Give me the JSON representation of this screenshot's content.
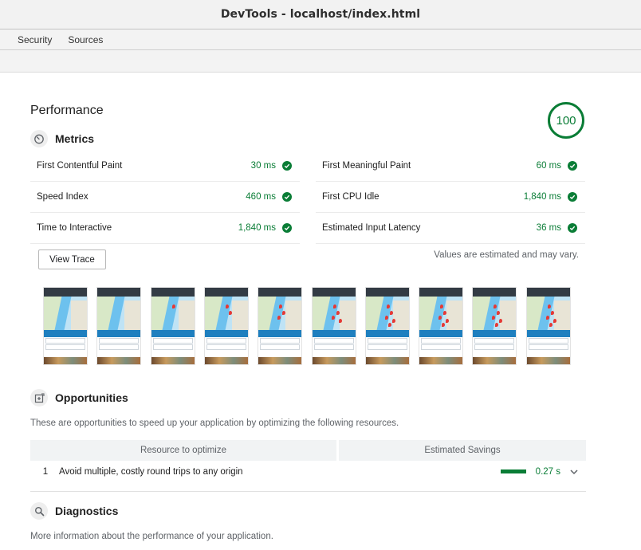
{
  "window": {
    "title": "DevTools - localhost/index.html"
  },
  "tabs": [
    {
      "label": "Security"
    },
    {
      "label": "Sources"
    }
  ],
  "report": {
    "category_title": "Performance",
    "score": "100",
    "metrics_heading": "Metrics",
    "metrics": [
      {
        "name": "First Contentful Paint",
        "value": "30 ms"
      },
      {
        "name": "First Meaningful Paint",
        "value": "60 ms"
      },
      {
        "name": "Speed Index",
        "value": "460 ms"
      },
      {
        "name": "First CPU Idle",
        "value": "1,840 ms"
      },
      {
        "name": "Time to Interactive",
        "value": "1,840 ms"
      },
      {
        "name": "Estimated Input Latency",
        "value": "36 ms"
      }
    ],
    "view_trace_label": "View Trace",
    "estimate_note": "Values are estimated and may vary.",
    "filmstrip_frames": 10,
    "opportunities_heading": "Opportunities",
    "opportunities_description": "These are opportunities to speed up your application by optimizing the following resources.",
    "opportunities_columns": [
      "Resource to optimize",
      "Estimated Savings"
    ],
    "opportunities": [
      {
        "index": "1",
        "name": "Avoid multiple, costly round trips to any origin",
        "savings": "0.27 s"
      }
    ],
    "diagnostics_heading": "Diagnostics",
    "diagnostics_description": "More information about the performance of your application."
  },
  "colors": {
    "pass_green": "#0a7d36",
    "header_bg": "#f2f2f2",
    "table_header_bg": "#f1f3f4"
  },
  "icons": {
    "metrics": "stopwatch-icon",
    "opportunities": "opportunity-icon",
    "diagnostics": "magnifier-icon",
    "pass": "check-circle-icon",
    "expand": "chevron-down-icon"
  }
}
